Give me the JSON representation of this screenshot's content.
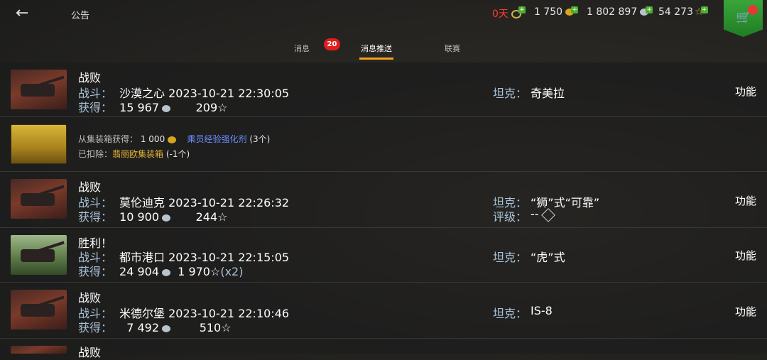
{
  "header": {
    "back_icon": "arrow-left-icon",
    "title": "公告",
    "premium_days": "0天",
    "gold": "1 750",
    "credits": "1 802 897",
    "free_xp": "54 273"
  },
  "tabs": [
    {
      "label": "消息",
      "badge": "20"
    },
    {
      "label": "消息推送",
      "active": true
    },
    {
      "label": "联赛"
    }
  ],
  "rows": [
    {
      "result": "战败",
      "battle_label": "战斗：",
      "map": "沙漠之心",
      "datetime": "2023-10-21 22:30:05",
      "earn_label": "获得：",
      "credits": "15 967",
      "xp": "209☆",
      "tank_label": "坦克：",
      "tank": "奇美拉",
      "action": "功能"
    },
    {
      "box_from": "从集装箱获得：",
      "box_gold": "1 000",
      "box_item": "乘员经验强化剂",
      "box_item_qty": "(3个)",
      "removed_label": "已扣除：",
      "removed_item": "翡丽欧集装箱",
      "removed_qty": "(-1个)"
    },
    {
      "result": "战败",
      "battle_label": "战斗：",
      "map": "莫伦迪克",
      "datetime": "2023-10-21 22:26:32",
      "earn_label": "获得：",
      "credits": "10 900",
      "xp": "244☆",
      "tank_label": "坦克：",
      "tank": "“狮”式“可靠”",
      "rating_label": "评级：",
      "rating": "--",
      "action": "功能"
    },
    {
      "result": "胜利！",
      "battle_label": "战斗：",
      "map": "都市港口",
      "datetime": "2023-10-21 22:15:05",
      "earn_label": "获得：",
      "credits": "24 904",
      "xp": "1 970☆",
      "multiplier": "(x2)",
      "tank_label": "坦克：",
      "tank": "“虎”式",
      "action": "功能"
    },
    {
      "result": "战败",
      "battle_label": "战斗：",
      "map": "米德尔堡",
      "datetime": "2023-10-21 22:10:46",
      "earn_label": "获得：",
      "credits": "7 492",
      "xp": "510☆",
      "tank_label": "坦克：",
      "tank": "IS-8",
      "action": "功能"
    },
    {
      "result": "战败"
    }
  ]
}
